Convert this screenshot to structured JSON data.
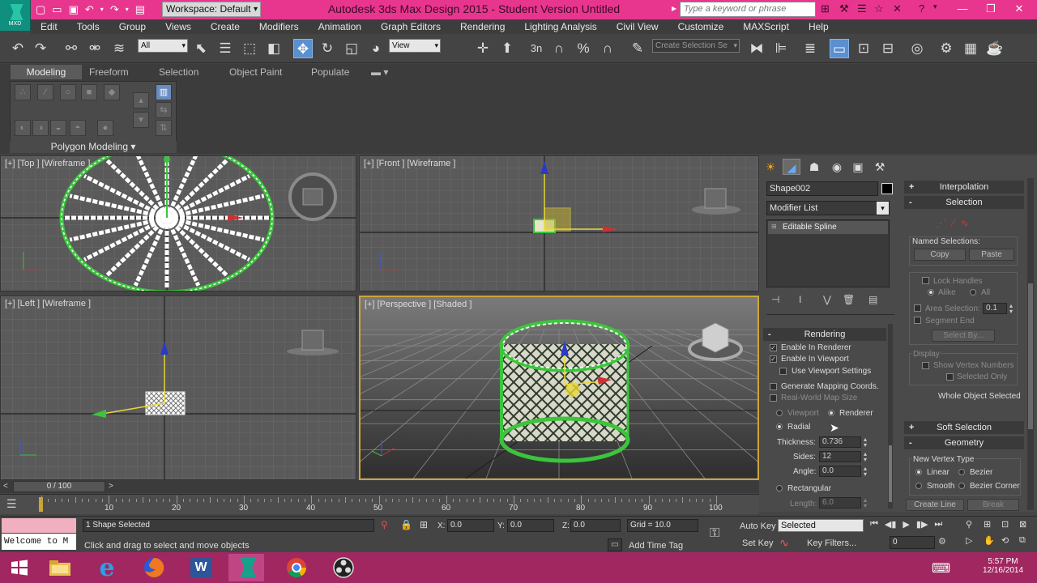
{
  "titlebar": {
    "app_icon_label": "MXD",
    "workspace": "Workspace: Default",
    "title": "Autodesk 3ds Max Design 2015  -  Student Version    Untitled",
    "search_placeholder": "Type a keyword or phrase"
  },
  "menu": [
    "Edit",
    "Tools",
    "Group",
    "Views",
    "Create",
    "Modifiers",
    "Animation",
    "Graph Editors",
    "Rendering",
    "Lighting Analysis",
    "Civil View",
    "Customize",
    "MAXScript",
    "Help"
  ],
  "toolbar": {
    "filter": "All",
    "ref_coord": "View",
    "named_selection_placeholder": "Create Selection Se",
    "snap_3": "3",
    "snap_n": "n"
  },
  "ribbon": {
    "tabs": [
      "Modeling",
      "Freeform",
      "Selection",
      "Object Paint",
      "Populate"
    ],
    "panel_label": "Polygon Modeling ▾"
  },
  "viewports": {
    "top": "[+] [Top ] [Wireframe ]",
    "front": "[+] [Front ] [Wireframe ]",
    "left": "[+] [Left ] [Wireframe ]",
    "perspective": "[+] [Perspective ] [Shaded ]"
  },
  "command_panel": {
    "object_name": "Shape002",
    "modifier_list": "Modifier List",
    "stack_item": "Editable Spline",
    "rendering": {
      "title": "Rendering",
      "enable_renderer": "Enable In Renderer",
      "enable_viewport": "Enable In Viewport",
      "use_viewport_settings": "Use Viewport Settings",
      "gen_mapping": "Generate Mapping Coords.",
      "real_world": "Real-World Map Size",
      "viewport": "Viewport",
      "renderer": "Renderer",
      "radial": "Radial",
      "thickness_label": "Thickness:",
      "thickness": "0.736",
      "sides_label": "Sides:",
      "sides": "12",
      "angle_label": "Angle:",
      "angle": "0.0",
      "rectangular": "Rectangular",
      "length_label": "Length:",
      "length": "6.0"
    },
    "right": {
      "interpolation": "Interpolation",
      "selection": "Selection",
      "named_selections": "Named Selections:",
      "copy": "Copy",
      "paste": "Paste",
      "lock_handles": "Lock Handles",
      "alike": "Alike",
      "all": "All",
      "area_selection": "Area Selection:",
      "area_value": "0.1",
      "segment_end": "Segment End",
      "select_by": "Select By...",
      "display": "Display",
      "show_vertex_numbers": "Show Vertex Numbers",
      "selected_only": "Selected Only",
      "whole_object_selected": "Whole Object Selected",
      "soft_selection": "Soft Selection",
      "geometry": "Geometry",
      "new_vertex_type": "New Vertex Type",
      "linear": "Linear",
      "bezier": "Bezier",
      "smooth": "Smooth",
      "bezier_corner": "Bezier Corner",
      "create_line": "Create Line",
      "break": "Break"
    },
    "signs": {
      "plus": "+",
      "minus": "-"
    }
  },
  "timeline": {
    "frame": "0 / 100",
    "ticks": [
      "10",
      "20",
      "30",
      "40",
      "50",
      "60",
      "70",
      "80",
      "90",
      "100"
    ]
  },
  "status": {
    "maxscript": "Welcome to M",
    "selection": "1 Shape Selected",
    "prompt": "Click and drag to select and move objects",
    "x_label": "X:",
    "x": "0.0",
    "y_label": "Y:",
    "y": "0.0",
    "z_label": "Z:",
    "z": "0.0",
    "grid": "Grid = 10.0",
    "add_time_tag": "Add Time Tag",
    "auto_key": "Auto Key",
    "set_key": "Set Key",
    "selected": "Selected",
    "key_filters": "Key Filters...",
    "frame_field": "0"
  },
  "taskbar": {
    "time": "5:57 PM",
    "date": "12/16/2014"
  },
  "colors": {
    "titlebar": "#e8368f",
    "taskbar": "#a0275f",
    "active_tool": "#5a8fd0",
    "viewport_bg": "#5a5a5a",
    "wire_white": "#ffffff",
    "wire_green": "#3cc43c",
    "perspective_border": "#caa53a"
  }
}
